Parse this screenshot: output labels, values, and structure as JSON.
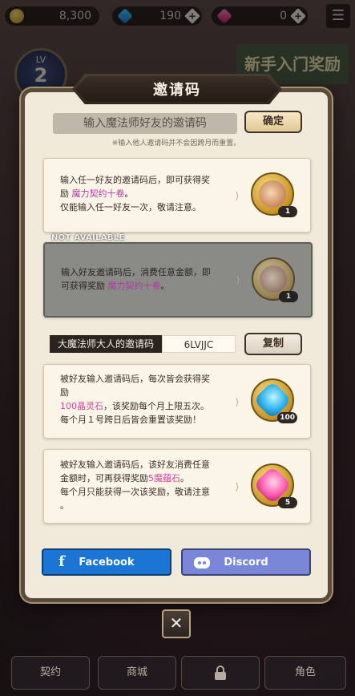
{
  "hud": {
    "gold": "8,300",
    "gems": "190",
    "crystals": "0",
    "level_label": "LV",
    "level": "2",
    "banner_text": "新手入门奖励"
  },
  "dialog": {
    "title": "邀请码",
    "input_placeholder": "输入魔法师好友的邀请码",
    "confirm_label": "确定",
    "note": "※输入他人邀请码并不会因跨月而重置。",
    "reward1": {
      "line1": "输入任一好友的邀请码后，即可获得奖",
      "line2_prefix": "励 ",
      "line2_highlight": "魔力契约十卷",
      "line2_suffix": "。",
      "line3": "仅能输入任一好友一次，敬请注意。",
      "count": "1",
      "icon": "contract-scroll-icon"
    },
    "not_available_label": "NOT AVAILABLE",
    "reward2": {
      "line1": "输入好友邀请码后，消费任意金额，即",
      "line2_prefix": "可获得奖励 ",
      "line2_highlight": "魔力契约十卷",
      "line2_suffix": "。",
      "count": "1",
      "icon": "contract-scroll-icon"
    },
    "own_code_label": "大魔法师大人的邀请码",
    "own_code": "6LVJJC",
    "copy_label": "复制",
    "reward3": {
      "line1": "被好友输入邀请码后，每次皆会获得奖",
      "line2": "励",
      "line3_highlight": "100晶灵石",
      "line3_suffix": "，该奖励每个月上限五次。",
      "line4": "每个月１号跨日后皆会重置该奖励！",
      "count": "100",
      "icon": "blue-gem-icon"
    },
    "reward4": {
      "line1": "被好友输入邀请码后，该好友消费任意",
      "line2_prefix": "金额时，可再获得奖励",
      "line2_highlight": "5魔蕴石",
      "line2_suffix": "。",
      "line3": "每个月只能获得一次该奖励，敬请注意",
      "line4": "。",
      "count": "5",
      "icon": "pink-crystal-icon"
    },
    "facebook_label": "Facebook",
    "discord_label": "Discord",
    "close_glyph": "✕"
  },
  "bottom_nav": {
    "item1": "契约",
    "item2": "商城",
    "item4": "角色"
  },
  "colors": {
    "panel_bg": "#f1eadb",
    "frame": "#5a4b3b",
    "highlight_purple": "#b23aa8",
    "highlight_pink": "#d1409c",
    "facebook": "#1b75d4",
    "discord": "#7a86d8"
  }
}
